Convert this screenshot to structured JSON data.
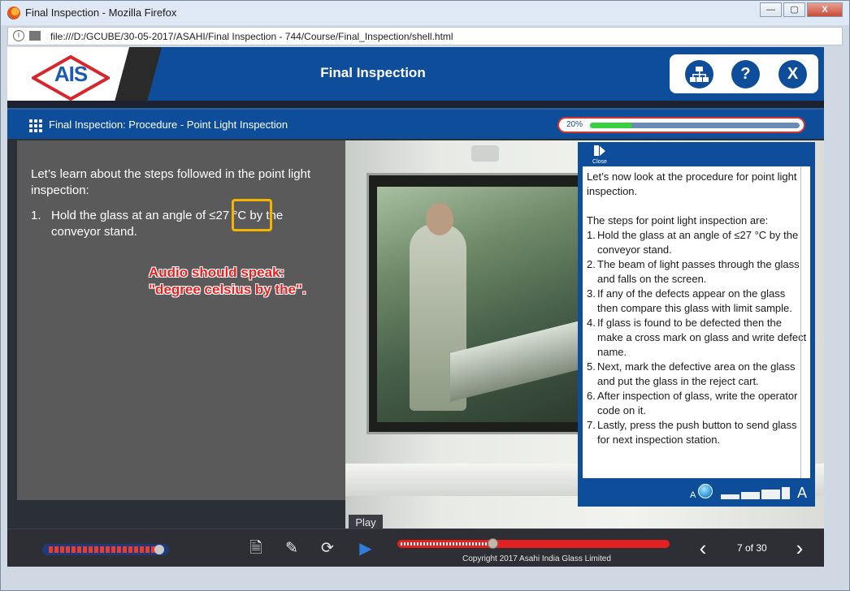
{
  "window": {
    "title": "Final Inspection - Mozilla Firefox",
    "minimize": "—",
    "maximize": "▢",
    "close": "X"
  },
  "browser": {
    "url": "file:///D:/GCUBE/30-05-2017/ASAHI/Final Inspection - 744/Course/Final_Inspection/shell.html"
  },
  "header": {
    "logo_text": "AIS",
    "title": "Final Inspection",
    "tools": [
      {
        "name": "sitemap",
        "glyph": "⊞"
      },
      {
        "name": "help",
        "glyph": "?"
      },
      {
        "name": "exit",
        "glyph": "X"
      }
    ]
  },
  "subheader": {
    "breadcrumb": "Final Inspection: Procedure - Point Light Inspection",
    "progress_label": "20%",
    "progress_value": 0.2
  },
  "content": {
    "intro": "Let’s learn about the steps followed in the point light inspection:",
    "step1_num": "1.",
    "step1_text": "Hold the glass at an angle of ≤27 °C by the conveyor stand.",
    "annotation_line1": "Audio should speak:",
    "annotation_line2": "\"degree celsius by the\"."
  },
  "panel": {
    "close_label": "Close",
    "intro": "Let’s now look at the procedure for point light inspection.",
    "steps_heading": "The steps for point light inspection are:",
    "steps": [
      {
        "num": "1.",
        "text": "Hold the glass at an angle of ≤27 °C by the conveyor stand."
      },
      {
        "num": "2.",
        "text": "The beam of light passes through the glass and falls on the screen."
      },
      {
        "num": "3.",
        "text": "If any of the defects appear on the glass then compare this glass with limit sample."
      },
      {
        "num": "4.",
        "text": "If glass is found to be defected then the make a cross mark on glass and write defect name."
      },
      {
        "num": "5.",
        "text": "Next, mark the defective area on the glass and put the glass in the reject cart."
      },
      {
        "num": "6.",
        "text": "After inspection of glass, write the operator code on it."
      },
      {
        "num": "7.",
        "text": "Lastly, press the push button to send glass for next inspection station."
      }
    ],
    "font_small": "A",
    "font_large": "A"
  },
  "footer": {
    "play_tooltip": "Play",
    "copyright": "Copyright 2017 Asahi India Glass Limited",
    "page_counter": "7 of 30",
    "prev": "‹",
    "next": "›",
    "icons": {
      "transcript": "🗎",
      "notes": "✎",
      "replay": "⟳",
      "play": "▶"
    }
  },
  "colors": {
    "brand_blue": "#0d4d9a",
    "accent_red": "#e52020",
    "progress_green": "#38d040",
    "highlight": "#f5b400"
  }
}
